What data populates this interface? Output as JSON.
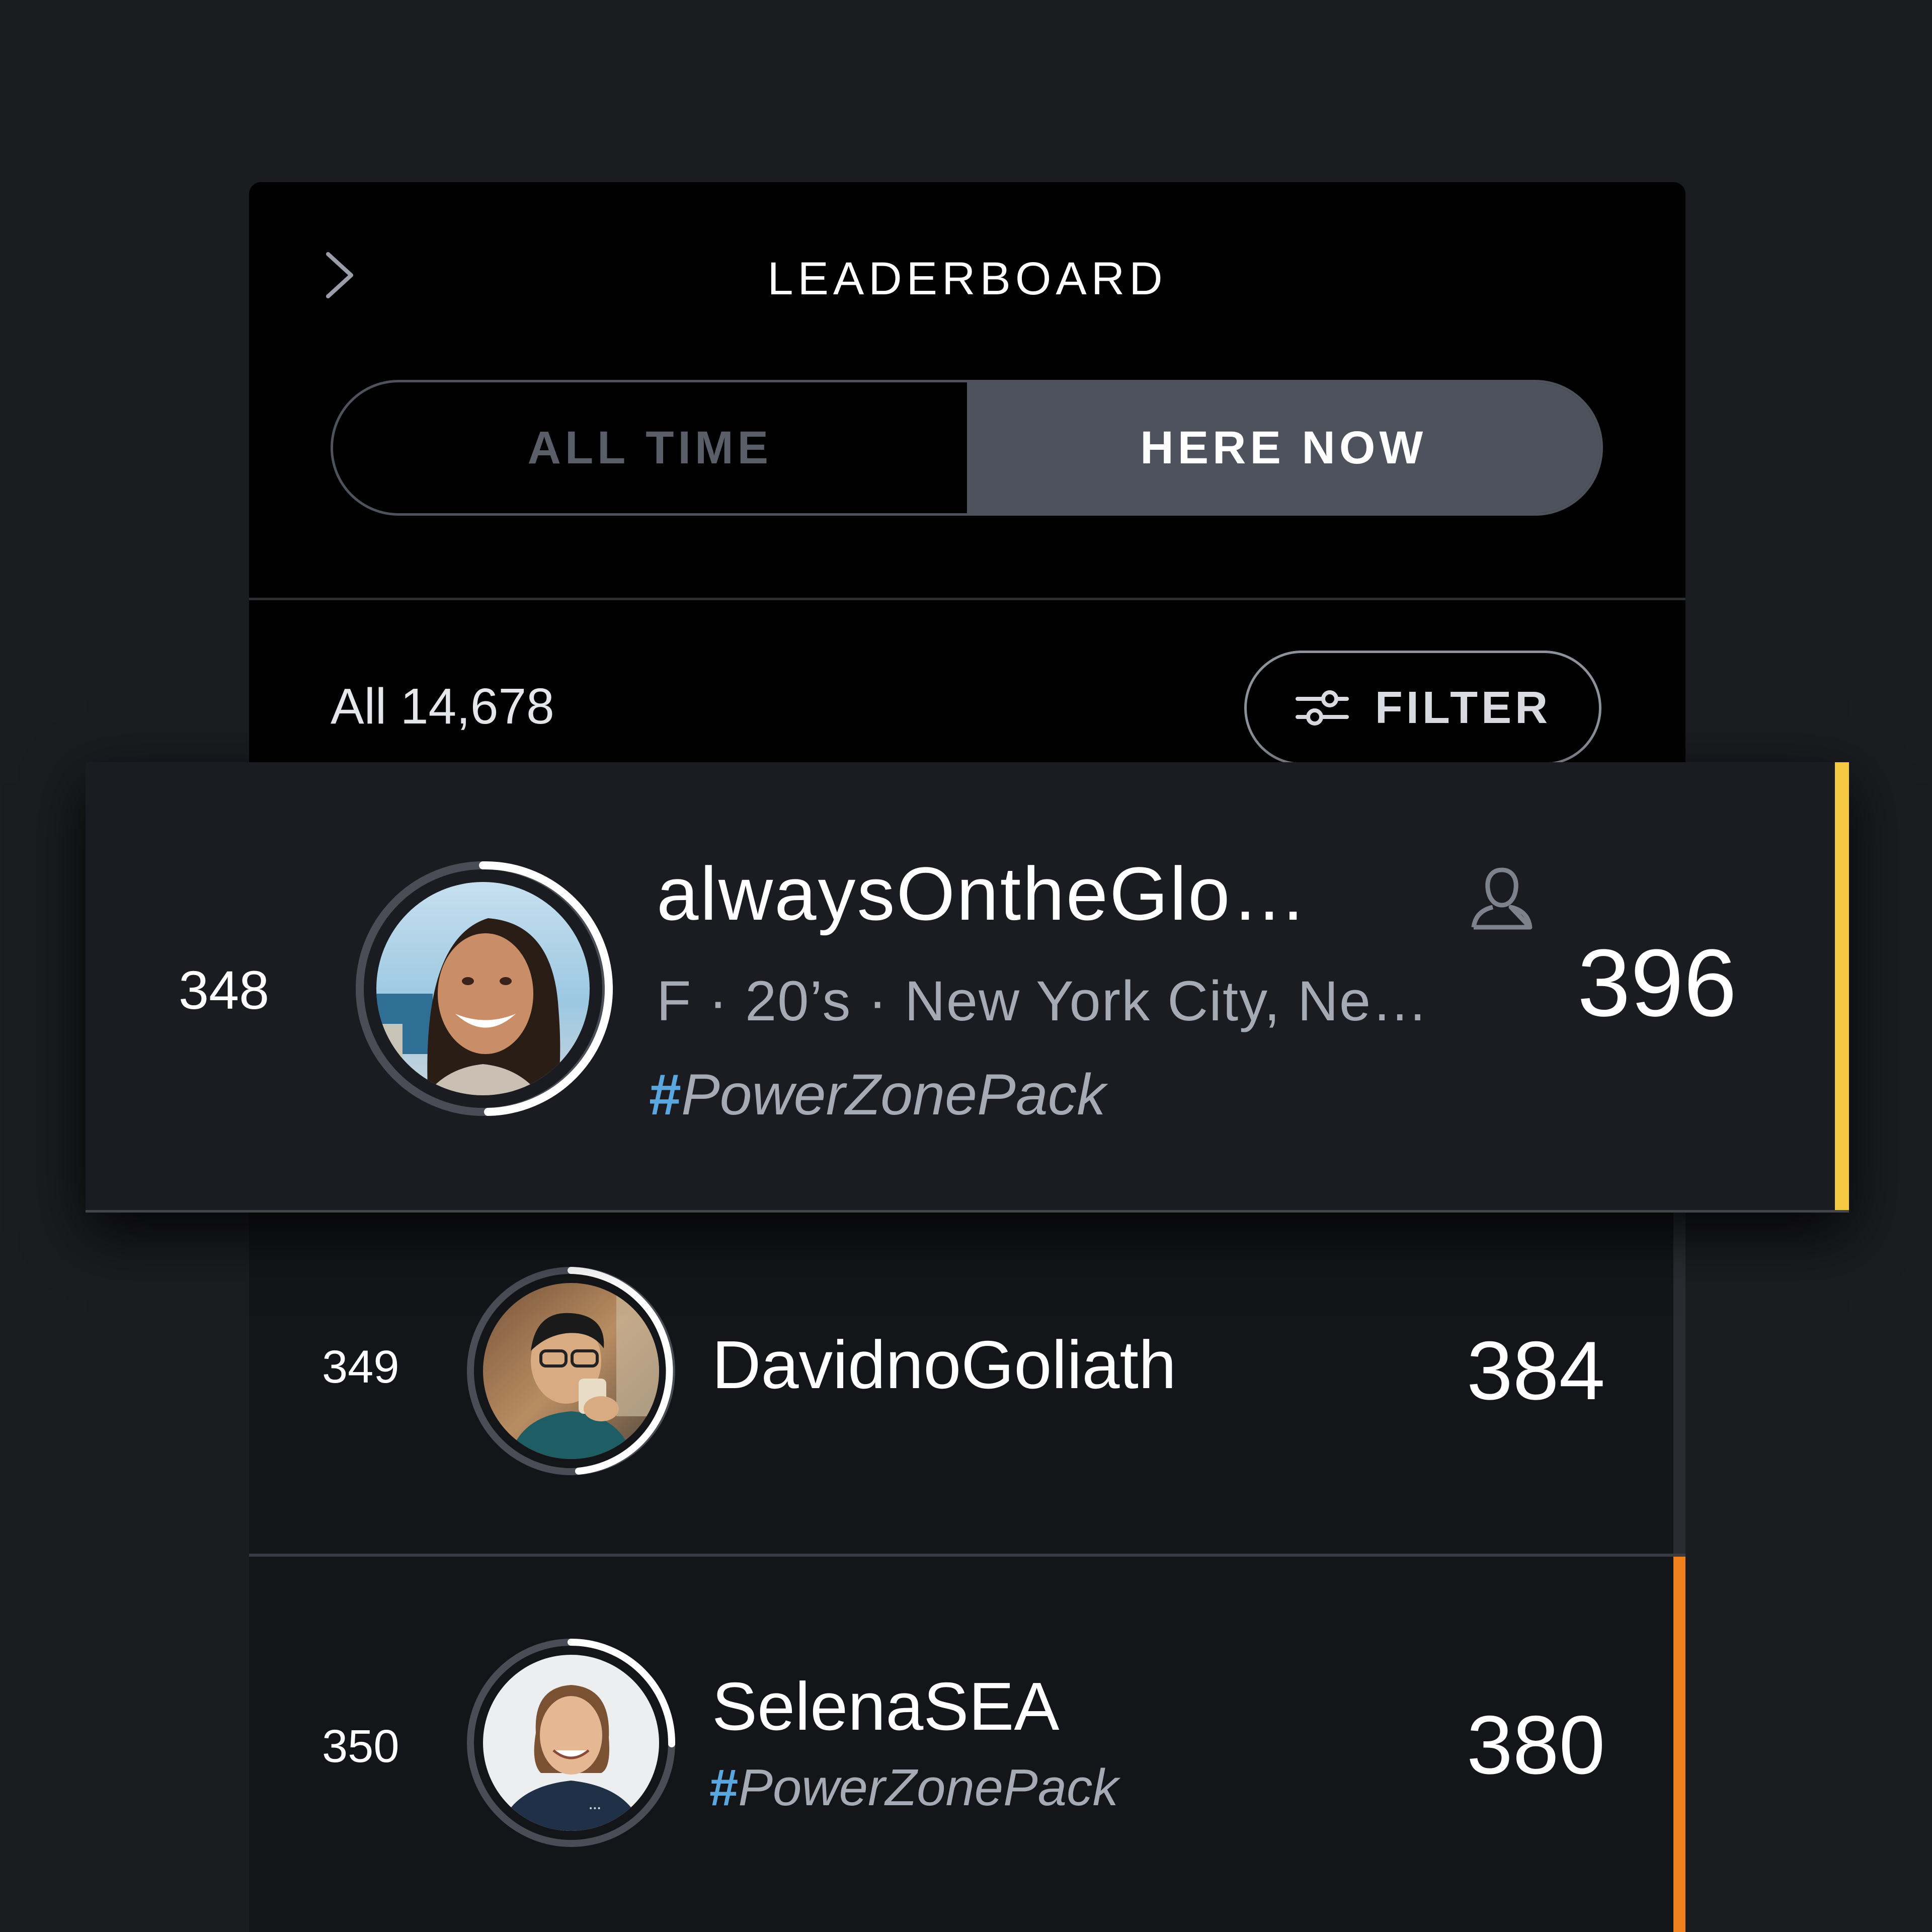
{
  "header": {
    "title": "LEADERBOARD",
    "back_icon": "chevron-right-icon"
  },
  "toggle": {
    "options": [
      "ALL TIME",
      "HERE NOW"
    ],
    "selected": "HERE NOW"
  },
  "summary": {
    "count_label": "All 14,678",
    "filter_label": "FILTER",
    "filter_icon": "sliders-icon"
  },
  "rows": [
    {
      "rank": "348",
      "name": "alwaysOntheGlo…",
      "meta": "F · 20’s · New York City, Ne…",
      "tag_hash": "#",
      "tag": "PowerZonePack",
      "score": "396",
      "accent_color": "#f5c842",
      "ring_progress": 0.5,
      "profile_icon": "user-icon",
      "highlighted": true
    },
    {
      "rank": "349",
      "name": "DavidnoGoliath",
      "score": "384",
      "accent_color": "#2a2c31",
      "ring_progress": 0.45
    },
    {
      "rank": "350",
      "name": "SelenaSEA",
      "tag_hash": "#",
      "tag": "PowerZonePack",
      "score": "380",
      "accent_color": "#f07f1e",
      "ring_progress": 0.4
    }
  ],
  "colors": {
    "background": "#1b1c20",
    "panel": "#000000",
    "row": "#141518",
    "toggle_active": "#4e525c",
    "hashtag": "#5aa7e0",
    "accent_gold": "#f5c842",
    "accent_orange": "#f07f1e"
  }
}
